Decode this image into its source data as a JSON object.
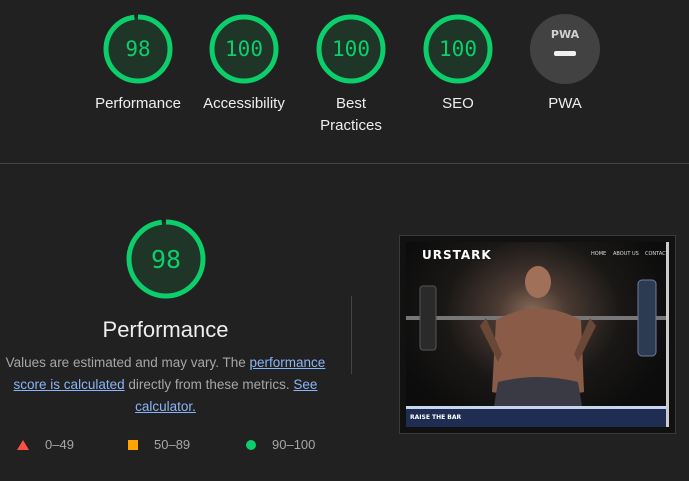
{
  "colors": {
    "good": "#0cce6b",
    "average": "#ffa400",
    "fail": "#ff4e42",
    "link": "#8ab4f8"
  },
  "categories": [
    {
      "score": "98",
      "label": "Performance",
      "fraction": 0.98
    },
    {
      "score": "100",
      "label": "Accessibility",
      "fraction": 1.0
    },
    {
      "score": "100",
      "label_line1": "Best",
      "label_line2": "Practices",
      "fraction": 1.0
    },
    {
      "score": "100",
      "label": "SEO",
      "fraction": 1.0
    },
    {
      "badge": "PWA",
      "label": "PWA"
    }
  ],
  "performance": {
    "score": "98",
    "fraction": 0.98,
    "title": "Performance",
    "desc_part1": "Values are estimated and may vary. The ",
    "link1": "performance score is calculated",
    "desc_part2": " directly from these metrics. ",
    "link2": "See calculator."
  },
  "legend": [
    {
      "icon": "triangle-icon",
      "range": "0–49"
    },
    {
      "icon": "square-icon",
      "range": "50–89"
    },
    {
      "icon": "circle-icon",
      "range": "90–100"
    }
  ],
  "screenshot": {
    "brand": "URSTARK",
    "nav": [
      "HOME",
      "ABOUT US",
      "CONTACT"
    ],
    "banner": "RAISE THE BAR"
  }
}
